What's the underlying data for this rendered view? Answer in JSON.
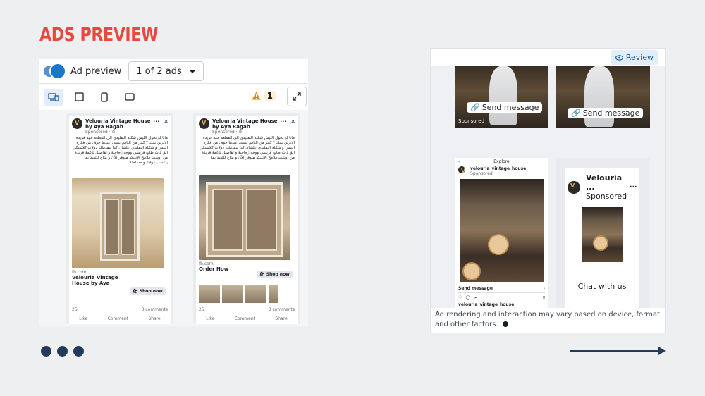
{
  "title": "ADS PREVIEW",
  "left_panel": {
    "toggle_label": "Ad preview",
    "ads_select": "1 of 2 ads",
    "warning_count": "1"
  },
  "cards": [
    {
      "page_name": "Velouria Vintage House by Aya Ragab",
      "sponsored": "Sponsored · ⊕",
      "text": "مانا لو تحول الليش شكله التقليدي الي القطعة فنية فريدة الانزين بيتك ؟ كثير من الناس بيبقى عندها خوف من فكرة التيش و شكله التقليدي علشان كدا بتقدملك دولاب كلاسيكي ابق ذات طابع فرنسي ووجه زجاجية و تفاصيل ناعمة فريدة من اوشت ملامح الانتيكه متوفر الآن و متاح للتفيد بما يتناسب ذوقك و مساحتك",
      "domain": "fb.com",
      "headline": "Velouria Vintage House by Aya",
      "cta": "🛍 Shop now",
      "reactions": "25",
      "comments": "3 comments",
      "actions": [
        "Like",
        "Comment",
        "Share"
      ]
    },
    {
      "page_name": "Velouria Vintage House by Aya Ragab",
      "sponsored": "Sponsored · ⊕",
      "text": "مانا لو تحول الليش شكله التقليدي الي القطعة فنية فريدة الانزين بيتك ؟ كثير من الناس بيبقى عندها خوف من فكرة التيش و شكله التقليدي علشان كدا بتقدملك دولاب كلاسيكي ابق ذات طابع فرنسي ووجه زجاجية و تفاصيل ناعمة فريدة من اوشت ملامح الانتيكه متوفر الآن و متاح للتفيد بما يتناسب ذوقك و مساحتك",
      "domain": "fb.com",
      "headline": "Order Now",
      "cta": "🛍 Shop now",
      "reactions": "25",
      "comments": "3 comments",
      "actions": [
        "Like",
        "Comment",
        "Share"
      ]
    }
  ],
  "right_panel": {
    "review_label": "Review",
    "send_message": "Send message",
    "sponsored": "Sponsored",
    "explore": "Explore",
    "insta_handle": "velouria_vintage_house",
    "insta_sponsored": "Sponsored",
    "insta_send": "Send message",
    "insta_bottom_handle": "velouria_vintage_house",
    "messenger_name": "Velouria ...",
    "messenger_sponsored": "Sponsored",
    "chat_with_us": "Chat with us",
    "disclaimer": "Ad rendering and interaction may vary based on device, format and other factors."
  }
}
